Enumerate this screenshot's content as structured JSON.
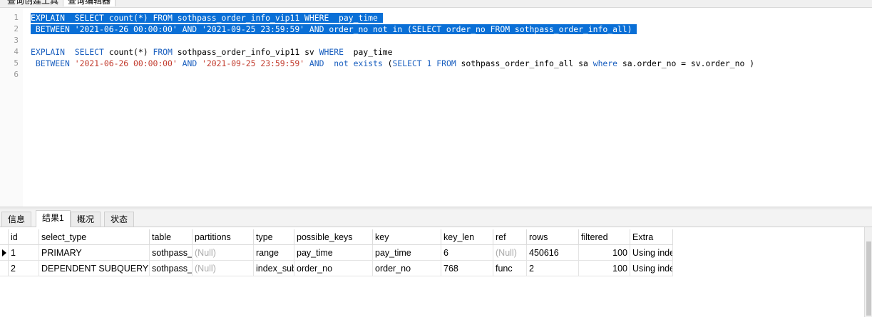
{
  "top_tabs": [
    "查询创建工具",
    "查询编辑器"
  ],
  "editor": {
    "line_numbers": [
      "1",
      "2",
      "3",
      "4",
      "5",
      "6"
    ],
    "selected_lines": [
      "EXPLAIN  SELECT count(*) FROM sothpass_order_info_vip11 WHERE  pay_time ",
      " BETWEEN '2021-06-26 00:00:00' AND '2021-09-25 23:59:59' AND order_no not in (SELECT order_no FROM sothpass_order_info_all) "
    ],
    "line4": {
      "t1": "EXPLAIN",
      "t2": "  ",
      "t3": "SELECT",
      "t4": " count(*) ",
      "t5": "FROM",
      "t6": " sothpass_order_info_vip11 sv ",
      "t7": "WHERE",
      "t8": "  pay_time"
    },
    "line5": {
      "t1": " ",
      "t2": "BETWEEN",
      "t3": " ",
      "t4": "'2021-06-26 00:00:00'",
      "t5": " ",
      "t6": "AND",
      "t7": " ",
      "t8": "'2021-09-25 23:59:59'",
      "t9": " ",
      "t10": "AND",
      "t11": "  ",
      "t12": "not exists",
      "t13": " (",
      "t14": "SELECT",
      "t15": " ",
      "t16": "1",
      "t17": " ",
      "t18": "FROM",
      "t19": " sothpass_order_info_all sa ",
      "t20": "where",
      "t21": " sa.order_no = sv.order_no )"
    }
  },
  "result_tabs": [
    "信息",
    "结果1",
    "概况",
    "状态"
  ],
  "grid": {
    "columns": [
      "id",
      "select_type",
      "table",
      "partitions",
      "type",
      "possible_keys",
      "key",
      "key_len",
      "ref",
      "rows",
      "filtered",
      "Extra"
    ],
    "rows": [
      [
        "1",
        "PRIMARY",
        "sothpass_",
        "(Null)",
        "range",
        "pay_time",
        "pay_time",
        "6",
        "(Null)",
        "450616",
        "100",
        "Using inde"
      ],
      [
        "2",
        "DEPENDENT SUBQUERY",
        "sothpass_",
        "(Null)",
        "index_sub",
        "order_no",
        "order_no",
        "768",
        "func",
        "2",
        "100",
        "Using inde"
      ]
    ]
  },
  "colors": {
    "selection": "#0a6fd6",
    "keyword": "#1a5fbf",
    "string": "#c23a2c",
    "null_text": "#aaaaaa"
  }
}
